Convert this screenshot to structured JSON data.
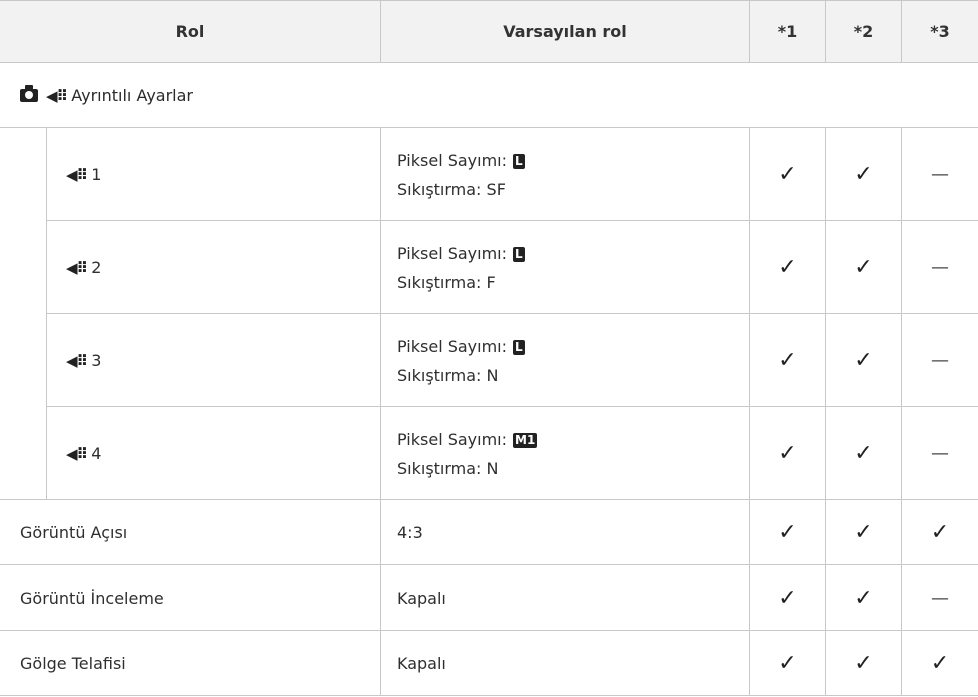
{
  "header": {
    "col_role": "Rol",
    "col_default": "Varsayılan rol",
    "col_1": "*1",
    "col_2": "*2",
    "col_3": "*3"
  },
  "section": {
    "title": "Ayrıntılı Ayarlar",
    "camera_icon": "camera-icon",
    "quality_icon": "image-quality-icon",
    "quality_symbol": "◀⠿"
  },
  "subrows": [
    {
      "num": "1",
      "line1": "Piksel Sayımı:",
      "badge": "L",
      "line2": "Sıkıştırma: SF",
      "c1": "✓",
      "c2": "✓",
      "c3": "—"
    },
    {
      "num": "2",
      "line1": "Piksel Sayımı:",
      "badge": "L",
      "line2": "Sıkıştırma: F",
      "c1": "✓",
      "c2": "✓",
      "c3": "—"
    },
    {
      "num": "3",
      "line1": "Piksel Sayımı:",
      "badge": "L",
      "line2": "Sıkıştırma: N",
      "c1": "✓",
      "c2": "✓",
      "c3": "—"
    },
    {
      "num": "4",
      "line1": "Piksel Sayımı:",
      "badge": "M1",
      "line2": "Sıkıştırma: N",
      "c1": "✓",
      "c2": "✓",
      "c3": "—"
    }
  ],
  "rows": [
    {
      "role": "Görüntü Açısı",
      "default": "4:3",
      "c1": "✓",
      "c2": "✓",
      "c3": "✓"
    },
    {
      "role": "Görüntü İnceleme",
      "default": "Kapalı",
      "c1": "✓",
      "c2": "✓",
      "c3": "—"
    },
    {
      "role": "Gölge Telafisi",
      "default": "Kapalı",
      "c1": "✓",
      "c2": "✓",
      "c3": "✓"
    }
  ]
}
